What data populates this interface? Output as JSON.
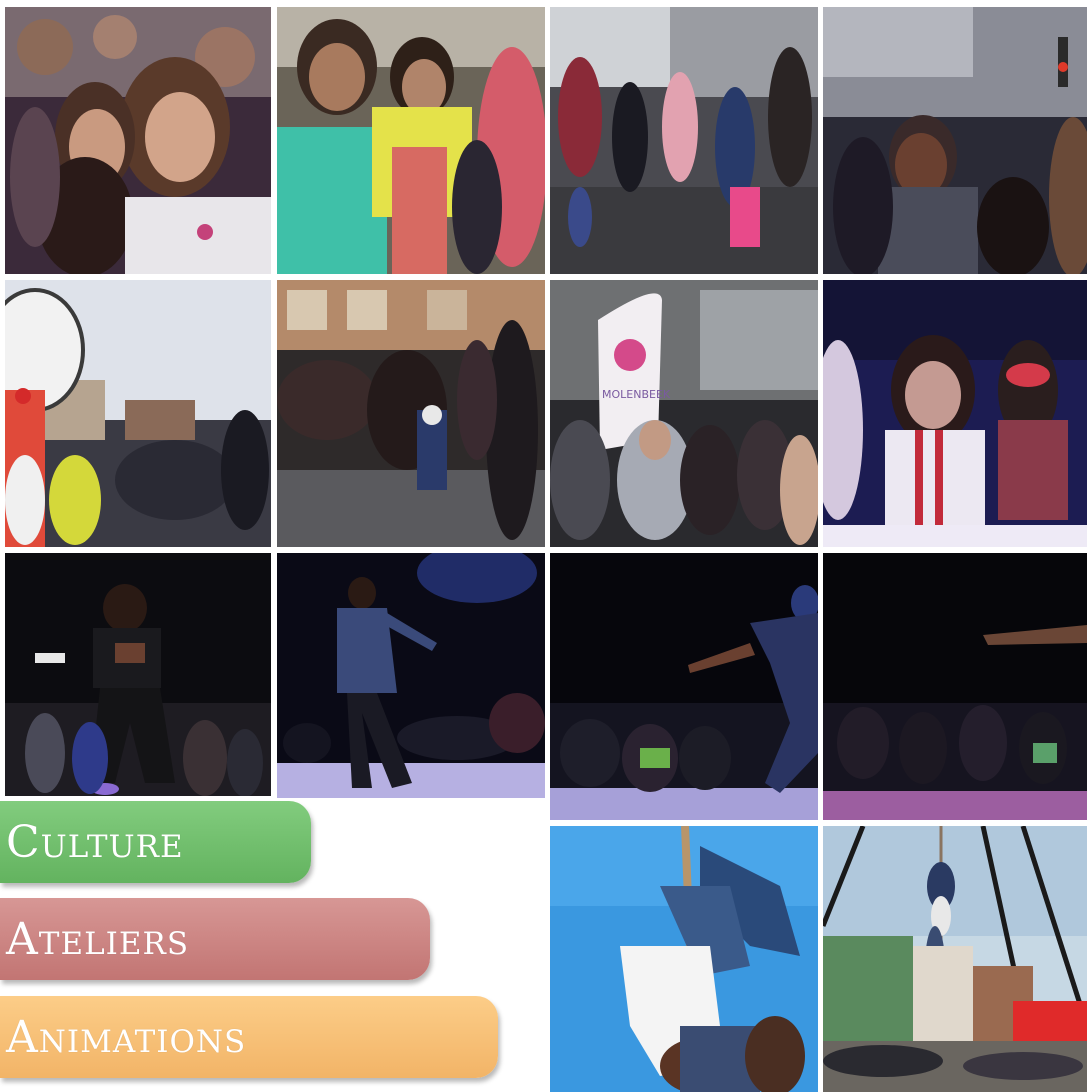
{
  "categories": {
    "culture": "Culture",
    "ateliers": "Ateliers",
    "animations": "Animations"
  },
  "colors": {
    "culture": "#6fbd6b",
    "ateliers": "#cd8381",
    "animations": "#f6c077"
  },
  "photos": [
    {
      "subject": "crowd of women and girls at street festival"
    },
    {
      "subject": "girls dancing in colorful clothes"
    },
    {
      "subject": "group dancing in the street"
    },
    {
      "subject": "smiling woman in crowd"
    },
    {
      "subject": "drummer with crowd in city square"
    },
    {
      "subject": "audience watching street performance"
    },
    {
      "subject": "festival crowd near pinwheel banner"
    },
    {
      "subject": "girls leaning on stage edge under blue light"
    },
    {
      "subject": "dancer performing in front of seated audience"
    },
    {
      "subject": "dancer on illuminated stage"
    },
    {
      "subject": "dancer reaching toward audience"
    },
    {
      "subject": "dancer arm extended over dark audience"
    },
    {
      "subject": "aerial rope acrobats against blue sky"
    },
    {
      "subject": "acrobats on rope in city square"
    }
  ],
  "banner_text": "MOLENBEEK"
}
